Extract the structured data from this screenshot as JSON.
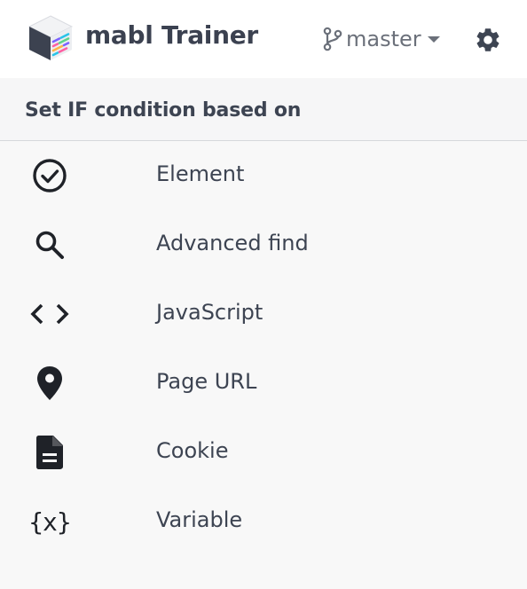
{
  "header": {
    "app_title": "mabl Trainer",
    "branch": "master",
    "icons": [
      "mabl-logo",
      "branch-icon",
      "caret-down-icon",
      "gear-icon"
    ]
  },
  "section": {
    "title": "Set IF condition based on"
  },
  "options": [
    {
      "label": "Element",
      "icon": "check-circle-icon"
    },
    {
      "label": "Advanced find",
      "icon": "search-icon"
    },
    {
      "label": "JavaScript",
      "icon": "code-icon"
    },
    {
      "label": "Page URL",
      "icon": "location-pin-icon"
    },
    {
      "label": "Cookie",
      "icon": "document-icon"
    },
    {
      "label": "Variable",
      "icon": "variable-icon",
      "glyph": "{x}"
    }
  ],
  "colors": {
    "text": "#3d4452",
    "icon": "#1f2228",
    "header_bg": "#ffffff",
    "panel_bg": "#f8f8f8",
    "divider": "#d6d8dc"
  }
}
